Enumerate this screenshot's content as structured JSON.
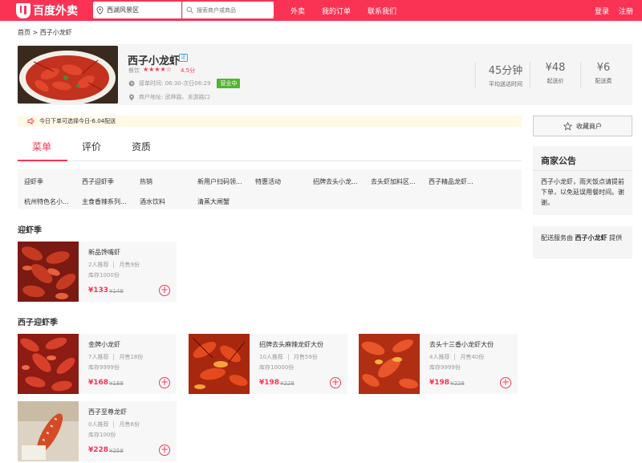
{
  "header": {
    "logo_text": "百度外卖",
    "location": "西湖风景区",
    "search_placeholder": "搜索商户或商品",
    "nav": [
      "外卖",
      "我的订单",
      "联系我们"
    ],
    "login": "登录",
    "register": "注册"
  },
  "breadcrumb": "首页 > 西子小龙虾",
  "shop": {
    "name": "西子小龙虾",
    "verify_badge": "证",
    "category": "餐饮",
    "stars": 4.5,
    "stars_text": "★★★★☆",
    "rating_text": "4.5分",
    "hours": "接单时间:  06:30-次日06:29",
    "status": "营业中",
    "address": "商户地址:  武林路、龙游路口",
    "stats": [
      {
        "value": "45分钟",
        "label": "平均送达时间"
      },
      {
        "value": "¥48",
        "label": "起送价"
      },
      {
        "value": "¥6",
        "label": "配送费"
      }
    ]
  },
  "promo": "今日下单可选择今日-6.04配送",
  "tabs": [
    "菜单",
    "评价",
    "资质"
  ],
  "categories": [
    [
      "迎虾季",
      "西子迎虾季",
      "热销",
      "新用户扫码领...",
      "特惠活动",
      "招牌去头小龙...",
      "去头虾加料区...",
      "西子精品龙虾..."
    ],
    [
      "杭州特色名小...",
      "主食香辣系列...",
      "酒水饮料",
      "清蒸大闸蟹"
    ]
  ],
  "sections": [
    {
      "title": "迎虾季",
      "items": [
        {
          "name": "新品馋嘴虾",
          "recommend": "2人推荐",
          "sold": "月售9份",
          "stock": "库存1000份",
          "price": "¥133",
          "original": "¥148"
        }
      ]
    },
    {
      "title": "西子迎虾季",
      "items": [
        {
          "name": "金牌小龙虾",
          "recommend": "7人推荐",
          "sold": "月售18份",
          "stock": "库存9999份",
          "price": "¥168",
          "original": "¥188"
        },
        {
          "name": "招牌去头麻辣龙虾大份",
          "recommend": "10人推荐",
          "sold": "月售59份",
          "stock": "库存10000份",
          "price": "¥198",
          "original": "¥228"
        },
        {
          "name": "去头十三香小龙虾大份",
          "recommend": "4人推荐",
          "sold": "月售40份",
          "stock": "库存9999份",
          "price": "¥198",
          "original": "¥228"
        },
        {
          "name": "西子至尊龙虾",
          "recommend": "0人推荐",
          "sold": "月售6份",
          "stock": "库存100份",
          "price": "¥228",
          "original": "¥258"
        }
      ]
    }
  ],
  "sidebar": {
    "favorite": "收藏商户",
    "notice_title": "商家公告",
    "notice_body": "西子小龙虾，雨天饭点请提前下单，以免延误用餐时间。谢谢。",
    "delivery_prefix": "配送服务由",
    "delivery_shop": "西子小龙虾",
    "delivery_suffix": "提供"
  },
  "colors": {
    "brand": "#fa3355",
    "open": "#52b52e"
  }
}
